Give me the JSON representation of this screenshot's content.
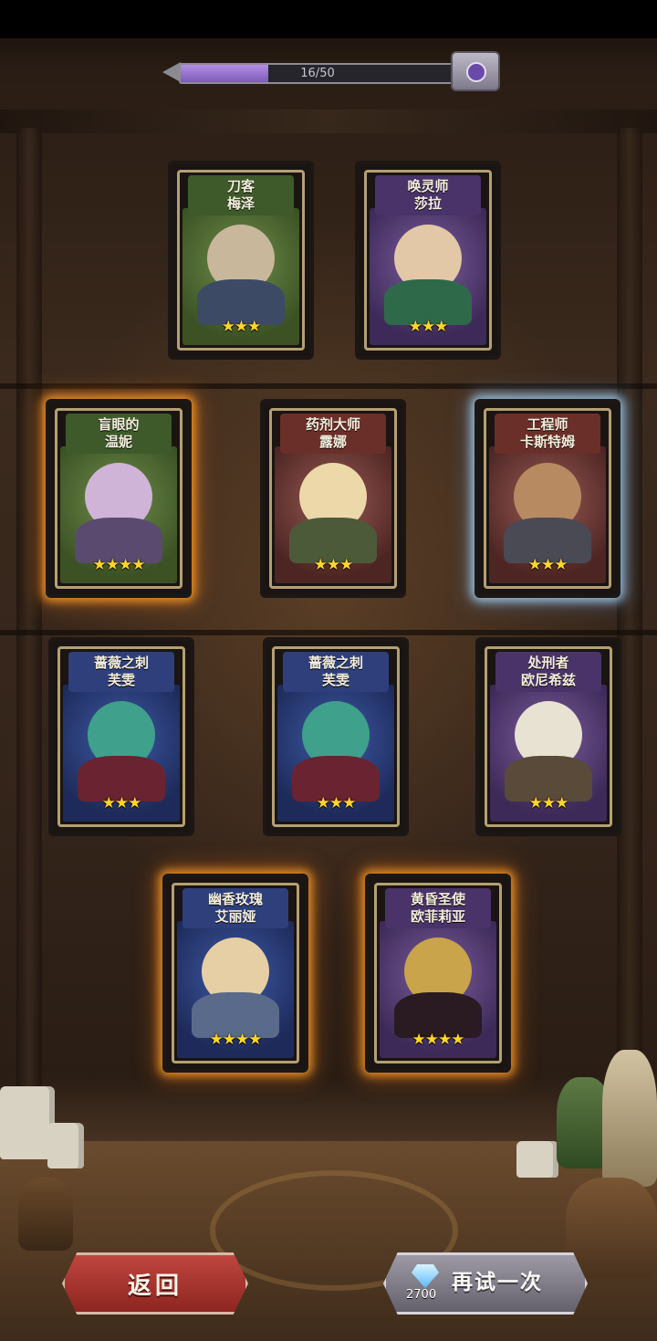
{
  "progress": {
    "text": "16/50",
    "current": 16,
    "total": 50
  },
  "cards": [
    {
      "line1": "刀客",
      "line2": "梅泽",
      "stars": "★★★",
      "star_count": 3,
      "theme": "green",
      "glow": "none"
    },
    {
      "line1": "唤灵师",
      "line2": "莎拉",
      "stars": "★★★",
      "star_count": 3,
      "theme": "purple",
      "glow": "none"
    },
    {
      "line1": "盲眼的",
      "line2": "温妮",
      "stars": "★★★★",
      "star_count": 4,
      "theme": "green",
      "glow": "gold"
    },
    {
      "line1": "药剂大师",
      "line2": "露娜",
      "stars": "★★★",
      "star_count": 3,
      "theme": "red",
      "glow": "none"
    },
    {
      "line1": "工程师",
      "line2": "卡斯特姆",
      "stars": "★★★",
      "star_count": 3,
      "theme": "red",
      "glow": "blue"
    },
    {
      "line1": "蔷薇之刺",
      "line2": "芙雯",
      "stars": "★★★",
      "star_count": 3,
      "theme": "blue",
      "glow": "none"
    },
    {
      "line1": "蔷薇之刺",
      "line2": "芙雯",
      "stars": "★★★",
      "star_count": 3,
      "theme": "blue",
      "glow": "none"
    },
    {
      "line1": "处刑者",
      "line2": "欧尼希兹",
      "stars": "★★★",
      "star_count": 3,
      "theme": "purple",
      "glow": "none"
    },
    {
      "line1": "幽香玫瑰",
      "line2": "艾丽娅",
      "stars": "★★★★",
      "star_count": 4,
      "theme": "blue",
      "glow": "gold"
    },
    {
      "line1": "黄昏圣使",
      "line2": "欧菲莉亚",
      "stars": "★★★★",
      "star_count": 4,
      "theme": "purple",
      "glow": "gold"
    }
  ],
  "buttons": {
    "back": "返回",
    "retry": "再试一次",
    "retry_cost": "2700",
    "retry_cost_icon": "diamond-icon"
  },
  "colors": {
    "gold_glow": "#ffa028",
    "blue_glow": "#aadcff",
    "progress_fill": "#9b78d4"
  }
}
